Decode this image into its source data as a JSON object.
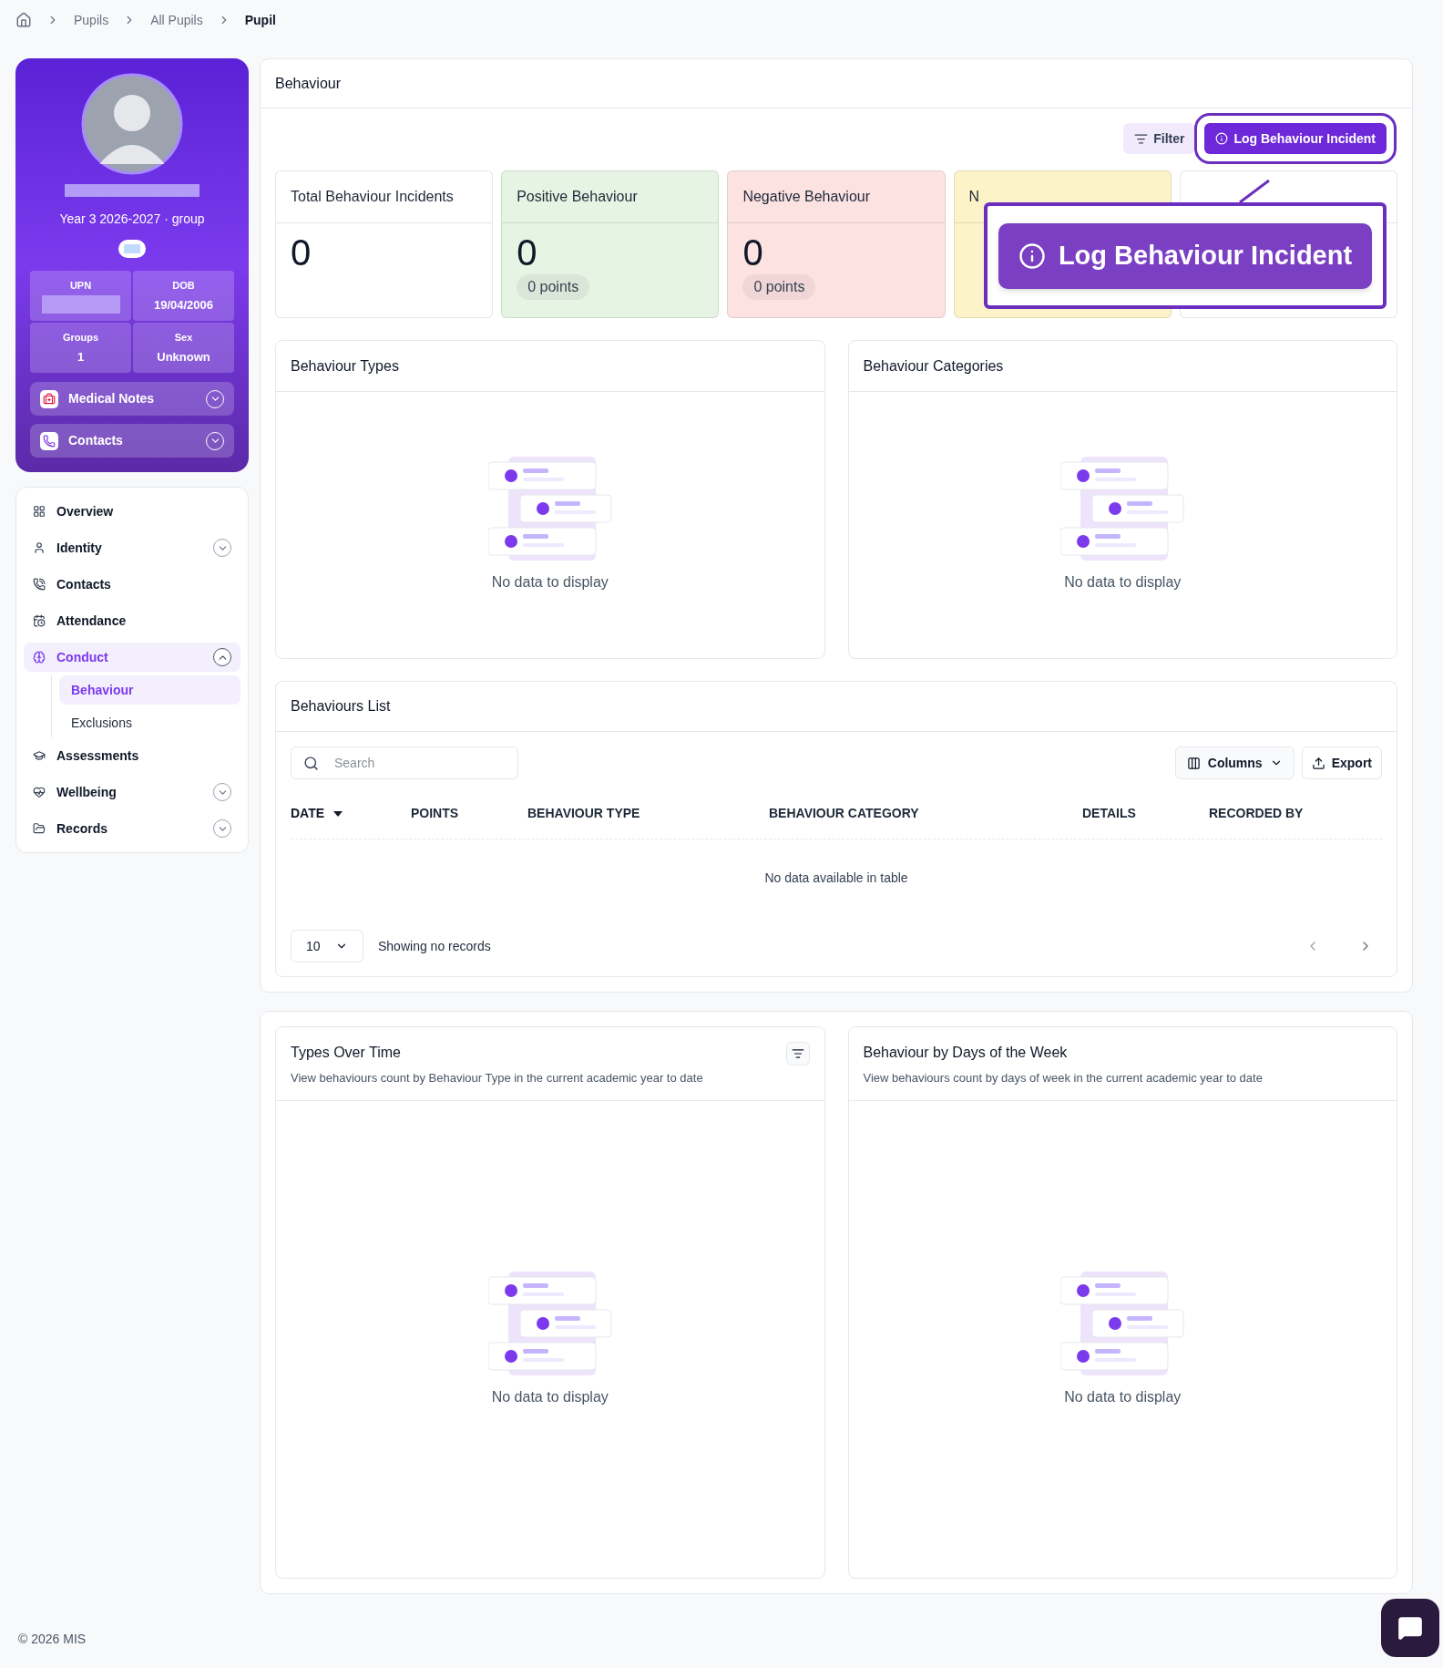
{
  "breadcrumb": [
    {
      "label": "Pupils",
      "selected": false
    },
    {
      "label": "All Pupils",
      "selected": false
    },
    {
      "label": "Pupil",
      "selected": true
    }
  ],
  "profile": {
    "group_line": "Year 3 2026-2027 · group",
    "stats": [
      {
        "label": "UPN",
        "kind": "hidden"
      },
      {
        "label": "DOB",
        "value": "19/04/2006",
        "kind": "text"
      },
      {
        "label": "Groups",
        "value": "1",
        "kind": "text"
      },
      {
        "label": "Sex",
        "value": "Unknown",
        "kind": "text"
      }
    ],
    "sections": [
      {
        "label": "Medical Notes",
        "kind": "medical",
        "expanded": false
      },
      {
        "label": "Contacts",
        "kind": "phone",
        "expanded": false
      }
    ]
  },
  "nav": [
    {
      "label": "Overview",
      "kind": "overview",
      "selected": false
    },
    {
      "label": "Identity",
      "kind": "person",
      "expanded": false,
      "selected": false
    },
    {
      "label": "Contacts",
      "kind": "phone",
      "selected": false
    },
    {
      "label": "Attendance",
      "kind": "calendar",
      "selected": false
    },
    {
      "label": "Conduct",
      "kind": "conduct",
      "expanded": true,
      "selected": true,
      "children": [
        {
          "label": "Behaviour",
          "selected": true
        },
        {
          "label": "Exclusions",
          "selected": false
        }
      ]
    },
    {
      "label": "Assessments",
      "kind": "cap",
      "selected": false
    },
    {
      "label": "Wellbeing",
      "kind": "heart",
      "expanded": false,
      "selected": false
    },
    {
      "label": "Records",
      "kind": "folder",
      "expanded": false,
      "selected": false
    }
  ],
  "behaviour": {
    "title": "Behaviour",
    "filter": "Filter",
    "log_button": "Log Behaviour Incident",
    "stats": [
      {
        "title": "Total Behaviour Incidents",
        "value": "0",
        "color": "#ffffff"
      },
      {
        "title": "Positive Behaviour",
        "value": "0",
        "points": "0 points",
        "color": "#e6f4e4"
      },
      {
        "title": "Negative Behaviour",
        "value": "0",
        "points": "0 points",
        "color": "#fde2e2"
      },
      {
        "title": "N",
        "color": "#fdf3c8"
      },
      {
        "color": "#ffffff"
      }
    ],
    "callout": {
      "label": "Log Behaviour Incident"
    },
    "panels": [
      {
        "title": "Behaviour Types",
        "empty": "No data to display"
      },
      {
        "title": "Behaviour Categories",
        "empty": "No data to display"
      }
    ],
    "list": {
      "title": "Behaviours List",
      "search_placeholder": "Search",
      "columns_button": "Columns",
      "export_button": "Export",
      "columns": [
        {
          "label": "DATE",
          "sorted": true
        },
        {
          "label": "POINTS",
          "sorted": false
        },
        {
          "label": "BEHAVIOUR TYPE",
          "sorted": false
        },
        {
          "label": "BEHAVIOUR CATEGORY",
          "sorted": false
        },
        {
          "label": "DETAILS",
          "sorted": false
        },
        {
          "label": "RECORDED BY",
          "sorted": false
        }
      ],
      "empty": "No data available in table",
      "page_size": "10",
      "status": "Showing no records"
    }
  },
  "trends": [
    {
      "title": "Types Over Time",
      "subtitle": "View behaviours count by Behaviour Type in the current academic year to date",
      "filter": true,
      "empty": "No data to display"
    },
    {
      "title": "Behaviour by Days of the Week",
      "subtitle": "View behaviours count by days of week in the current academic year to date",
      "filter": false,
      "empty": "No data to display"
    }
  ],
  "footer": "© 2026 MIS"
}
